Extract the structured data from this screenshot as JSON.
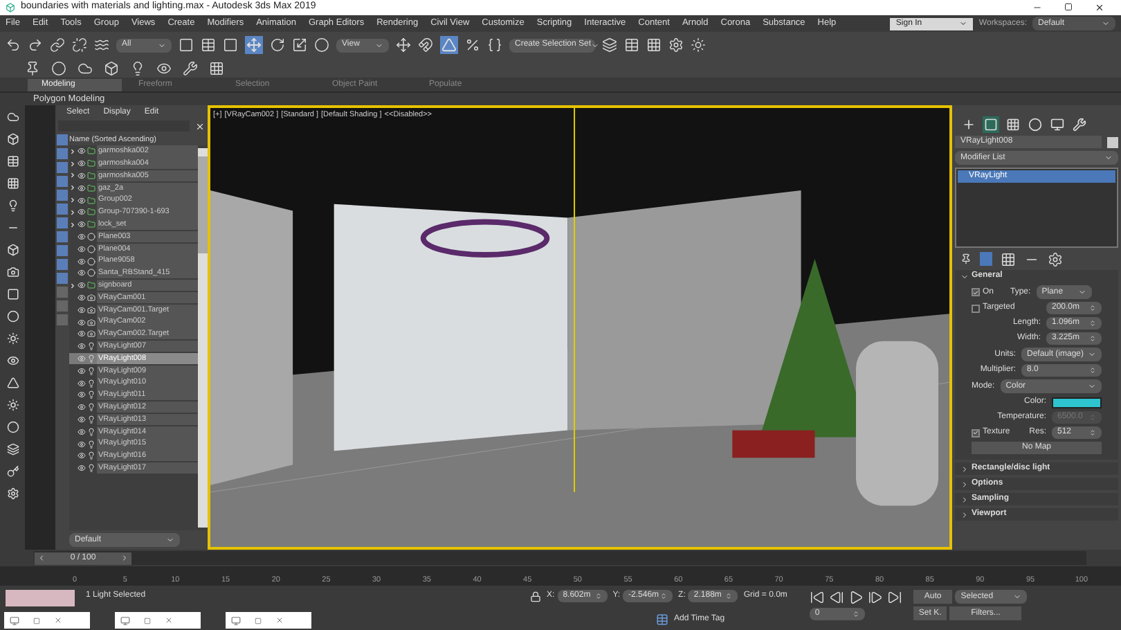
{
  "window": {
    "title": "boundaries with materials and lighting.max - Autodesk 3ds Max 2019"
  },
  "menu": [
    "File",
    "Edit",
    "Tools",
    "Group",
    "Views",
    "Create",
    "Modifiers",
    "Animation",
    "Graph Editors",
    "Rendering",
    "Civil View",
    "Customize",
    "Scripting",
    "Interactive",
    "Content",
    "Arnold",
    "Corona",
    "Substance",
    "Help"
  ],
  "account": {
    "sign_in": "Sign In",
    "workspaces_label": "Workspaces:",
    "workspace": "Default"
  },
  "toolbar": {
    "selection_filter": "All",
    "reference_coord": "View",
    "selection_set": "Create Selection Set"
  },
  "ribbon": {
    "tabs": [
      {
        "label": "Modeling",
        "selected": true
      },
      {
        "label": "Freeform",
        "selected": false
      },
      {
        "label": "Selection",
        "selected": false
      },
      {
        "label": "Object Paint",
        "selected": false
      },
      {
        "label": "Populate",
        "selected": false
      }
    ],
    "panel": "Polygon Modeling"
  },
  "scene_explorer": {
    "menu": [
      "Select",
      "Display",
      "Edit"
    ],
    "column": "Name (Sorted Ascending)",
    "rows": [
      {
        "name": "garmoshka002",
        "kind": "group",
        "expandable": true,
        "selected": false
      },
      {
        "name": "garmoshka004",
        "kind": "group",
        "expandable": true,
        "selected": false
      },
      {
        "name": "garmoshka005",
        "kind": "group",
        "expandable": true,
        "selected": false
      },
      {
        "name": "gaz_2a",
        "kind": "group",
        "expandable": true,
        "selected": false
      },
      {
        "name": "Group002",
        "kind": "group",
        "expandable": true,
        "selected": false
      },
      {
        "name": "Group-707390-1-693",
        "kind": "group",
        "expandable": true,
        "selected": false
      },
      {
        "name": "lock_set",
        "kind": "group",
        "expandable": true,
        "selected": false
      },
      {
        "name": "Plane003",
        "kind": "geometry",
        "expandable": false,
        "selected": false
      },
      {
        "name": "Plane004",
        "kind": "geometry",
        "expandable": false,
        "selected": false
      },
      {
        "name": "Plane9058",
        "kind": "geometry",
        "expandable": false,
        "selected": false
      },
      {
        "name": "Santa_RBStand_415",
        "kind": "geometry",
        "expandable": false,
        "selected": false
      },
      {
        "name": "signboard",
        "kind": "group",
        "expandable": true,
        "selected": false
      },
      {
        "name": "VRayCam001",
        "kind": "camera",
        "expandable": false,
        "selected": false
      },
      {
        "name": "VRayCam001.Target",
        "kind": "camera",
        "expandable": false,
        "selected": false
      },
      {
        "name": "VRayCam002",
        "kind": "camera",
        "expandable": false,
        "selected": false
      },
      {
        "name": "VRayCam002.Target",
        "kind": "camera",
        "expandable": false,
        "selected": false
      },
      {
        "name": "VRayLight007",
        "kind": "light",
        "expandable": false,
        "selected": false
      },
      {
        "name": "VRayLight008",
        "kind": "light",
        "expandable": false,
        "selected": true
      },
      {
        "name": "VRayLight009",
        "kind": "light",
        "expandable": false,
        "selected": false
      },
      {
        "name": "VRayLight010",
        "kind": "light",
        "expandable": false,
        "selected": false
      },
      {
        "name": "VRayLight011",
        "kind": "light",
        "expandable": false,
        "selected": false
      },
      {
        "name": "VRayLight012",
        "kind": "light",
        "expandable": false,
        "selected": false
      },
      {
        "name": "VRayLight013",
        "kind": "light",
        "expandable": false,
        "selected": false
      },
      {
        "name": "VRayLight014",
        "kind": "light",
        "expandable": false,
        "selected": false
      },
      {
        "name": "VRayLight015",
        "kind": "light",
        "expandable": false,
        "selected": false
      },
      {
        "name": "VRayLight016",
        "kind": "light",
        "expandable": false,
        "selected": false
      },
      {
        "name": "VRayLight017",
        "kind": "light",
        "expandable": false,
        "selected": false
      }
    ],
    "layer": "Default"
  },
  "viewport": {
    "labels": [
      "[+]",
      "[VRayCam002 ]",
      "[Standard ]",
      "[Default Shading ]",
      "<<Disabled>>"
    ]
  },
  "command_panel": {
    "tabs": [
      {
        "kind": "create",
        "selected": false
      },
      {
        "kind": "modify",
        "selected": true
      },
      {
        "kind": "hierarchy",
        "selected": false
      },
      {
        "kind": "motion",
        "selected": false
      },
      {
        "kind": "display",
        "selected": false
      },
      {
        "kind": "utilities",
        "selected": false
      }
    ],
    "object_name": "VRayLight008",
    "modifier_list": "Modifier List",
    "stack": [
      {
        "label": "VRayLight",
        "selected": true
      }
    ],
    "general": {
      "title": "General",
      "on": {
        "label": "On",
        "checked": true
      },
      "type_label": "Type:",
      "type": "Plane",
      "targeted": {
        "label": "Targeted",
        "checked": false
      },
      "target_distance": "200.0m",
      "length_label": "Length:",
      "length": "1.096m",
      "width_label": "Width:",
      "width": "3.225m",
      "units_label": "Units:",
      "units": "Default (image)",
      "multiplier_label": "Multiplier:",
      "multiplier": "8.0",
      "mode_label": "Mode:",
      "mode": "Color",
      "color_label": "Color:",
      "color": "#2ec4d0",
      "temperature_label": "Temperature:",
      "temperature": "6500.0",
      "texture": {
        "label": "Texture",
        "checked": true
      },
      "res_label": "Res:",
      "res": "512",
      "map": "No Map"
    },
    "rollouts": [
      "Rectangle/disc light",
      "Options",
      "Sampling",
      "Viewport"
    ]
  },
  "timeline": {
    "frame": "0 / 100",
    "level": 0,
    "ticks": [
      "0",
      "5",
      "10",
      "15",
      "20",
      "25",
      "30",
      "35",
      "40",
      "45",
      "50",
      "55",
      "60",
      "65",
      "70",
      "75",
      "80",
      "85",
      "90",
      "95",
      "100"
    ]
  },
  "status": {
    "message": "1 Light Selected",
    "x_label": "X:",
    "y_label": "Y:",
    "z_label": "Z:",
    "x": "8.602m",
    "y": "-2.546m",
    "z": "2.188m",
    "grid": "Grid = 0.0m",
    "time_tag": "Add Time Tag",
    "frame": "0",
    "auto": "Auto",
    "set_key": "Set K.",
    "key_filter": "Selected",
    "filters": "Filters..."
  }
}
